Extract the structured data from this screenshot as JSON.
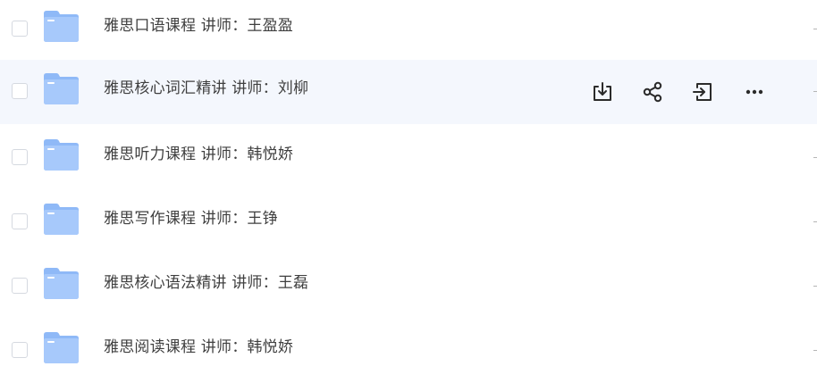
{
  "files": [
    {
      "name": "雅思口语课程 讲师：王盈盈",
      "hovered": false
    },
    {
      "name": "雅思核心词汇精讲 讲师：刘柳",
      "hovered": true
    },
    {
      "name": "雅思听力课程 讲师：韩悦娇",
      "hovered": false
    },
    {
      "name": "雅思写作课程 讲师：王铮",
      "hovered": false
    },
    {
      "name": "雅思核心语法精讲 讲师：王磊",
      "hovered": false
    },
    {
      "name": "雅思阅读课程 讲师：韩悦娇",
      "hovered": false
    }
  ],
  "row_actions": [
    {
      "icon": "download-icon"
    },
    {
      "icon": "share-icon"
    },
    {
      "icon": "move-to-icon"
    },
    {
      "icon": "more-icon"
    }
  ],
  "colors": {
    "hover_background": "#f4f7fd",
    "folder_back": "#8fb9f7",
    "folder_front": "#a7c9fb",
    "icon": "#2b2b2b"
  }
}
